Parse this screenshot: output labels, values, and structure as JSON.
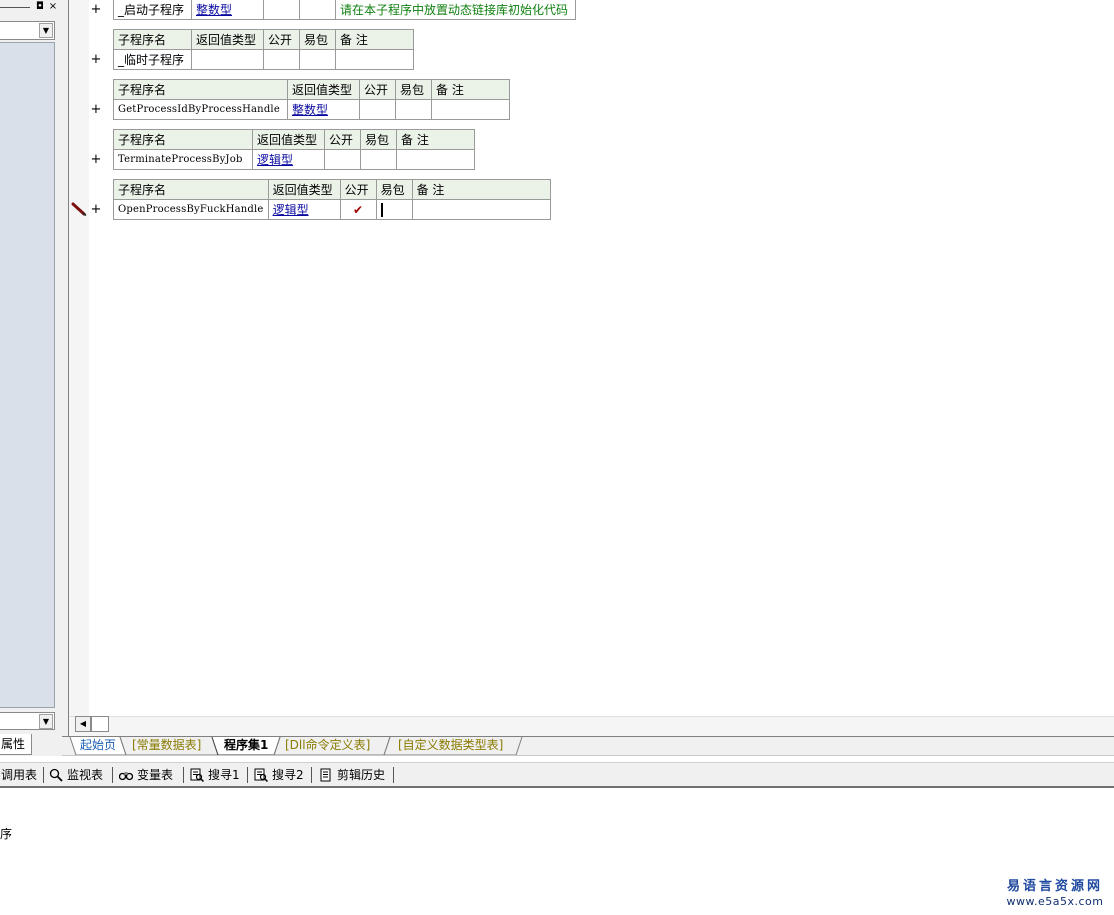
{
  "left_panel": {
    "window_buttons": [
      "◘",
      "×"
    ],
    "properties_tab": "属性"
  },
  "subprograms": [
    {
      "name": "_启动子程序",
      "return_type": "整数型",
      "public": "",
      "easy_pack": "",
      "note": "请在本子程序中放置动态链接库初始化代码",
      "header_visible": false
    },
    {
      "header": {
        "name": "子程序名",
        "return_type": "返回值类型",
        "public": "公开",
        "easy_pack": "易包",
        "note": "备 注"
      },
      "name": "_临时子程序",
      "return_type": "",
      "public": "",
      "easy_pack": "",
      "note": ""
    },
    {
      "header": {
        "name": "子程序名",
        "return_type": "返回值类型",
        "public": "公开",
        "easy_pack": "易包",
        "note": "备 注"
      },
      "name": "GetProcessIdByProcessHandle",
      "return_type": "整数型",
      "public": "",
      "easy_pack": "",
      "note": ""
    },
    {
      "header": {
        "name": "子程序名",
        "return_type": "返回值类型",
        "public": "公开",
        "easy_pack": "易包",
        "note": "备 注"
      },
      "name": "TerminateProcessByJob",
      "return_type": "逻辑型",
      "public": "",
      "easy_pack": "",
      "note": ""
    },
    {
      "header": {
        "name": "子程序名",
        "return_type": "返回值类型",
        "public": "公开",
        "easy_pack": "易包",
        "note": "备 注"
      },
      "name": "OpenProcessByFuckHandle",
      "return_type": "逻辑型",
      "public": "✔",
      "easy_pack": "",
      "note": ""
    }
  ],
  "expand_symbol": "+",
  "tabs": [
    {
      "label": "起始页",
      "active": false,
      "color": "#1a5fb4"
    },
    {
      "label": "[常量数据表]",
      "active": false,
      "color": "#8a7a00"
    },
    {
      "label": "程序集1",
      "active": true,
      "color": "#000000"
    },
    {
      "label": "[Dll命令定义表]",
      "active": false,
      "color": "#8a7a00"
    },
    {
      "label": "[自定义数据类型表]",
      "active": false,
      "color": "#8a7a00"
    }
  ],
  "toolbar": {
    "call_table": "调用表",
    "watch_table": "监视表",
    "var_table": "变量表",
    "search1": "搜寻1",
    "search2": "搜寻2",
    "clip_history": "剪辑历史"
  },
  "output": {
    "text": "序"
  },
  "watermark": {
    "title": "易语言资源网",
    "url": "www.e5a5x.com"
  }
}
